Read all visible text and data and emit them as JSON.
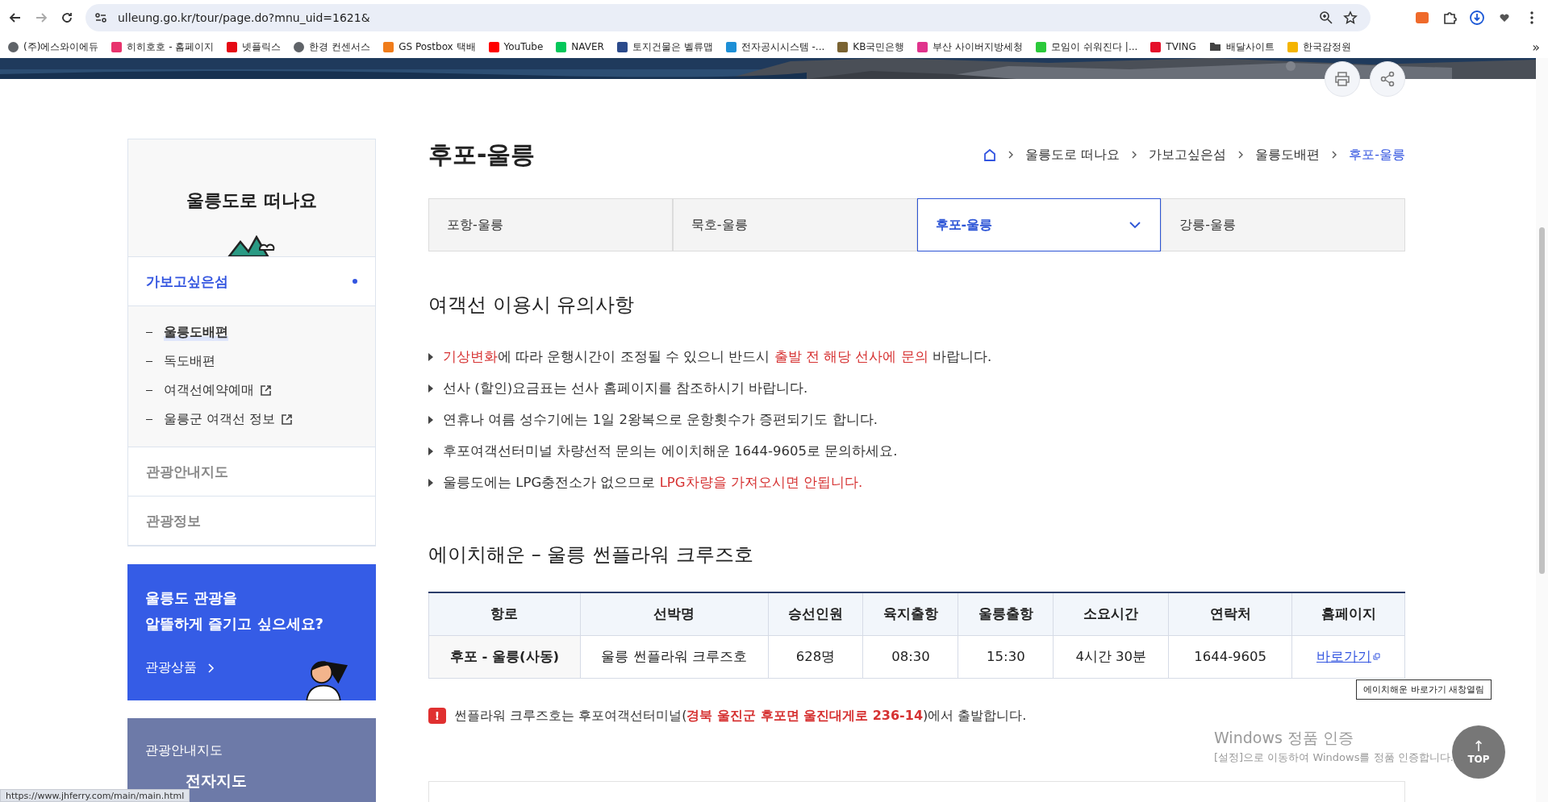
{
  "browser": {
    "url": "ulleung.go.kr/tour/page.do?mnu_uid=1621&",
    "bookmarks": [
      {
        "label": "(주)에스와이에듀",
        "kind": "globe",
        "color": "#5f6368"
      },
      {
        "label": "히히호호 - 홈페이지",
        "kind": "favicon",
        "color": "#e8336d"
      },
      {
        "label": "넷플릭스",
        "kind": "favicon",
        "color": "#e50914"
      },
      {
        "label": "한경 컨센서스",
        "kind": "globe",
        "color": "#5f6368"
      },
      {
        "label": "GS Postbox 택배",
        "kind": "favicon",
        "color": "#f07c1a"
      },
      {
        "label": "YouTube",
        "kind": "favicon",
        "color": "#ff0000"
      },
      {
        "label": "NAVER",
        "kind": "favicon",
        "color": "#03c75a"
      },
      {
        "label": "토지건물은 벨류맵",
        "kind": "favicon",
        "color": "#2b4a8b"
      },
      {
        "label": "전자공시시스템 -...",
        "kind": "favicon",
        "color": "#1d8fd6"
      },
      {
        "label": "KB국민은행",
        "kind": "favicon",
        "color": "#7a6332"
      },
      {
        "label": "부산 사이버지방세청",
        "kind": "favicon",
        "color": "#e0338c"
      },
      {
        "label": "모임이 쉬워진다 |...",
        "kind": "favicon",
        "color": "#2bc93a"
      },
      {
        "label": "TVING",
        "kind": "favicon",
        "color": "#e5102a"
      },
      {
        "label": "배달사이트",
        "kind": "folder",
        "color": "#444444"
      },
      {
        "label": "한국감정원",
        "kind": "favicon",
        "color": "#f4b400"
      }
    ],
    "more": "»",
    "status_url": "https://www.jhferry.com/main/main.html"
  },
  "sidebar": {
    "title": "울릉도로 떠나요",
    "menu": [
      {
        "label": "가보고싶은섬",
        "active": true,
        "children": [
          {
            "label": "울릉도배편",
            "selected": true,
            "external": false
          },
          {
            "label": "독도배편",
            "selected": false,
            "external": false
          },
          {
            "label": "여객선예약예매",
            "selected": false,
            "external": true
          },
          {
            "label": "울릉군 여객선 정보",
            "selected": false,
            "external": true
          }
        ]
      },
      {
        "label": "관광안내지도",
        "active": false
      },
      {
        "label": "관광정보",
        "active": false
      }
    ],
    "banner": {
      "lines": [
        "울릉도 관광을",
        "알뜰하게 즐기고 싶으세요?"
      ],
      "link": "관광상품"
    },
    "map_box": {
      "title": "관광안내지도",
      "link": "전자지도"
    }
  },
  "page": {
    "title": "후포-울릉",
    "breadcrumb": [
      "울릉도로 떠나요",
      "가보고싶은섬",
      "울릉도배편",
      "후포-울릉"
    ],
    "tabs": [
      {
        "label": "포항-울릉",
        "selected": false
      },
      {
        "label": "묵호-울릉",
        "selected": false
      },
      {
        "label": "후포-울릉",
        "selected": true
      },
      {
        "label": "강릉-울릉",
        "selected": false
      }
    ],
    "notice_heading": "여객선 이용시 유의사항",
    "notices": [
      [
        {
          "text": "기상변화",
          "highlight": true
        },
        {
          "text": "에 따라 운행시간이 조정될 수 있으니 반드시 ",
          "highlight": false
        },
        {
          "text": "출발 전 해당 선사에 문의",
          "highlight": true
        },
        {
          "text": " 바랍니다.",
          "highlight": false
        }
      ],
      [
        {
          "text": "선사 (할인)요금표는 선사 홈페이지를 참조하시기 바랍니다.",
          "highlight": false
        }
      ],
      [
        {
          "text": "연휴나 여름 성수기에는 1일 2왕복으로 운항횟수가 증편되기도 합니다.",
          "highlight": false
        }
      ],
      [
        {
          "text": "후포여객선터미널 차량선적 문의는 에이치해운 1644-9605로 문의하세요.",
          "highlight": false
        }
      ],
      [
        {
          "text": "울릉도에는 LPG충전소가 없으므로 ",
          "highlight": false
        },
        {
          "text": "LPG차량을 가져오시면 안됩니다.",
          "highlight": true
        }
      ]
    ],
    "ship_heading": "에이치해운 – 울릉 썬플라워 크루즈호",
    "table": {
      "columns": [
        "항로",
        "선박명",
        "승선인원",
        "육지출항",
        "울릉출항",
        "소요시간",
        "연락처",
        "홈페이지"
      ],
      "rows": [
        {
          "route": "후포 - 울릉(사동)",
          "ship": "울릉 썬플라워 크루즈호",
          "capacity": "628명",
          "depart_land": "08:30",
          "depart_ulleung": "15:30",
          "duration": "4시간 30분",
          "phone": "1644-9605",
          "link": "바로가기",
          "tooltip": "에이치해운 바로가기 새창열림"
        }
      ]
    },
    "warning": [
      {
        "text": "썬플라워 크루즈호는 후포여객선터미널(",
        "highlight": false
      },
      {
        "text": "경북 울진군 후포면 울진대게로 236-14",
        "highlight": true
      },
      {
        "text": ")에서 출발합니다.",
        "highlight": false
      }
    ],
    "warning_icon": "!",
    "top_button": {
      "arrow": "↑",
      "label": "TOP"
    }
  },
  "os_watermark": {
    "title": "Windows 정품 인증",
    "text": "[설정]으로 이동하여 Windows를 정품 인증합니다."
  }
}
